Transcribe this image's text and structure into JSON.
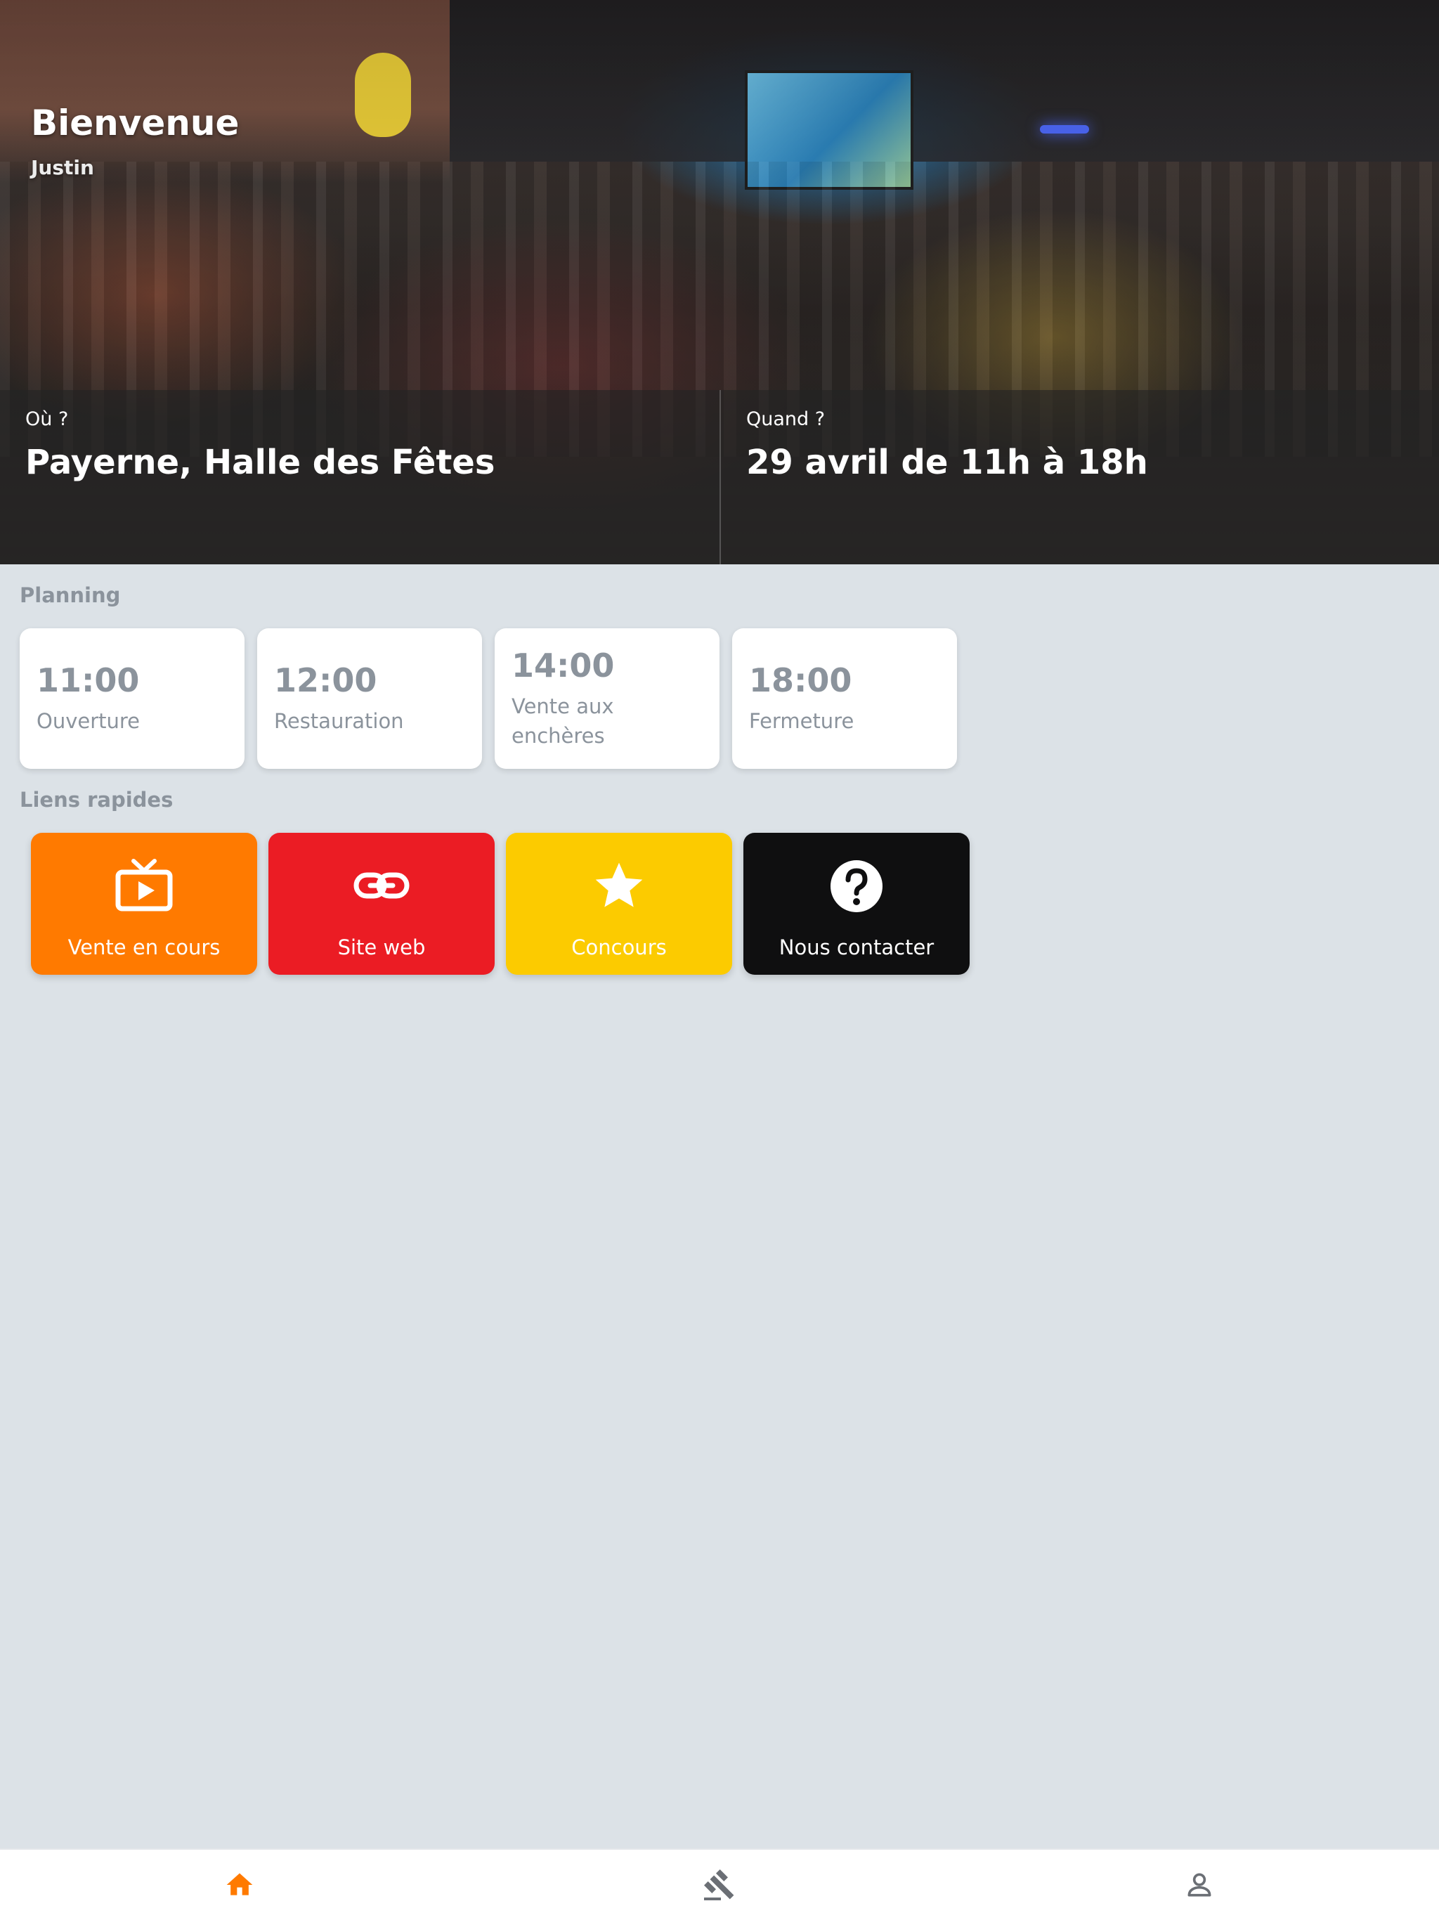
{
  "hero": {
    "title": "Bienvenue",
    "user": "Justin",
    "where_label": "Où ?",
    "where_value": "Payerne, Halle des Fêtes",
    "when_label": "Quand ?",
    "when_value": "29 avril de 11h à 18h"
  },
  "planning": {
    "title": "Planning",
    "items": [
      {
        "time": "11:00",
        "label": "Ouverture"
      },
      {
        "time": "12:00",
        "label": "Restauration"
      },
      {
        "time": "14:00",
        "label": "Vente aux enchères"
      },
      {
        "time": "18:00",
        "label": "Fermeture"
      }
    ]
  },
  "quick_links": {
    "title": "Liens rapides",
    "items": [
      {
        "label": "Vente en cours",
        "icon": "tv-icon",
        "color": "#ff7a00"
      },
      {
        "label": "Site web",
        "icon": "link-icon",
        "color": "#eb1c24"
      },
      {
        "label": "Concours",
        "icon": "star-icon",
        "color": "#fccb00"
      },
      {
        "label": "Nous contacter",
        "icon": "help-icon",
        "color": "#0f0f10"
      }
    ]
  },
  "bottom_nav": {
    "items": [
      {
        "icon": "home-icon",
        "active": true,
        "color": "#ff7a00"
      },
      {
        "icon": "gavel-icon",
        "active": false,
        "color": "#6b6f75"
      },
      {
        "icon": "user-icon",
        "active": false,
        "color": "#6b6f75"
      }
    ]
  }
}
